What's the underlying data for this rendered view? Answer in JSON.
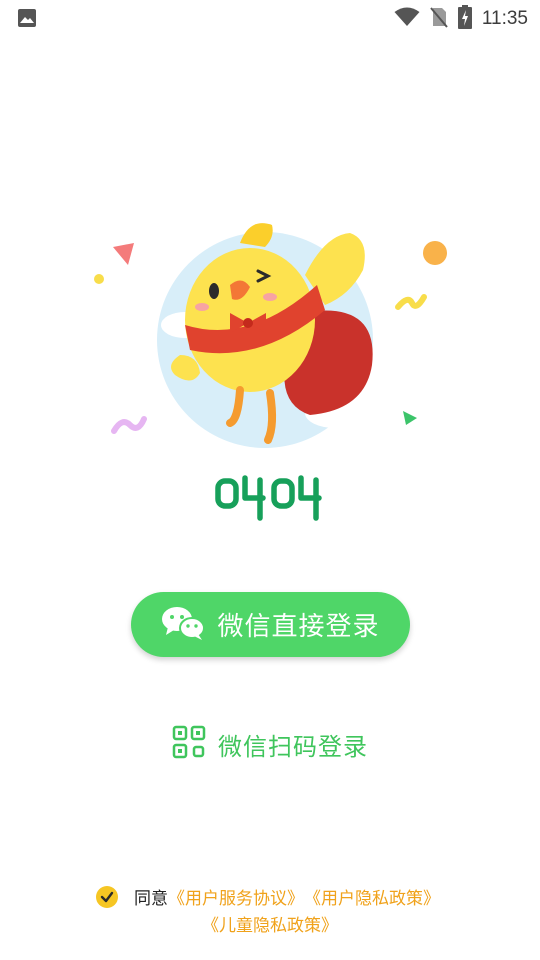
{
  "status_bar": {
    "time": "11:35"
  },
  "logo": {
    "text": "0404"
  },
  "wechat_login": {
    "label": "微信直接登录"
  },
  "qr_login": {
    "label": "微信扫码登录"
  },
  "agreement": {
    "prefix": "同意",
    "user_agreement": "《用户服务协议》",
    "privacy_policy": "《用户隐私政策》",
    "children_privacy": "《儿童隐私政策》"
  },
  "colors": {
    "brand_green": "#4fd668",
    "link_orange": "#f0a21b",
    "check_yellow": "#f6c623",
    "logo_green": "#17a05a"
  }
}
